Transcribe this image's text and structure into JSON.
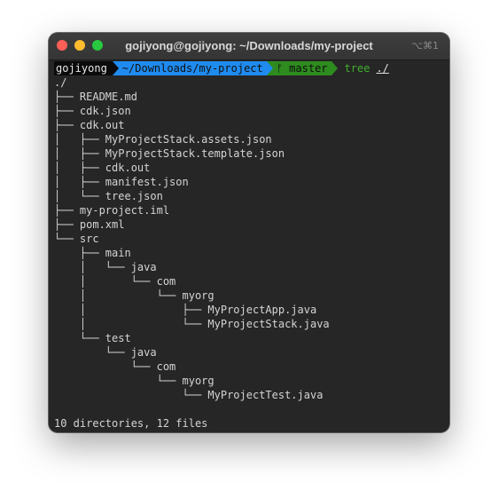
{
  "window": {
    "title": "gojiyong@gojiyong: ~/Downloads/my-project",
    "shortcut": "⌥⌘1"
  },
  "prompt": {
    "user": "gojiyong",
    "path": "~/Downloads/my-project",
    "branch": "ᚠ master",
    "command": "tree",
    "argument": "./"
  },
  "tree_lines": [
    "./",
    "├── README.md",
    "├── cdk.json",
    "├── cdk.out",
    "│   ├── MyProjectStack.assets.json",
    "│   ├── MyProjectStack.template.json",
    "│   ├── cdk.out",
    "│   ├── manifest.json",
    "│   └── tree.json",
    "├── my-project.iml",
    "├── pom.xml",
    "└── src",
    "    ├── main",
    "    │   └── java",
    "    │       └── com",
    "    │           └── myorg",
    "    │               ├── MyProjectApp.java",
    "    │               └── MyProjectStack.java",
    "    └── test",
    "        └── java",
    "            └── com",
    "                └── myorg",
    "                    └── MyProjectTest.java"
  ],
  "summary": "10 directories, 12 files",
  "colors": {
    "background": "#262626",
    "path_segment": "#1f8bef",
    "branch_segment": "#2e8b1f",
    "command": "#3fae2c"
  }
}
